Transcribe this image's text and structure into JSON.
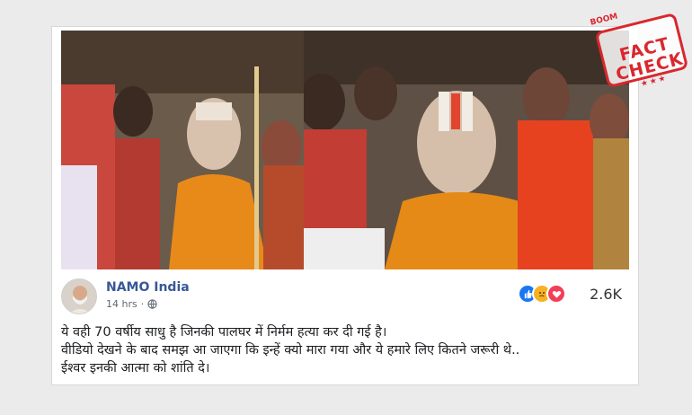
{
  "post": {
    "page_name": "NAMO India",
    "time": "14 hrs",
    "reaction_count": "2.6K",
    "reactions": [
      "like-icon",
      "sad-icon",
      "love-icon"
    ],
    "lines": [
      "ये वही 70 वर्षीय साधु है जिनकी पालघर में निर्मम हत्या कर दी गई है।",
      "वीडियो देखने के बाद समझ आ जाएगा कि इन्हें क्यो मारा गया और ये हमारे लिए कितने जरूरी थे..",
      "ईश्वर इनकी आत्मा को शांति दे।"
    ]
  },
  "stamp": {
    "brand": "BOOM",
    "line1": "FACT",
    "line2": "CHECK",
    "stars": "★★★"
  },
  "colors": {
    "page_name": "#385898",
    "stamp_red": "#d9272e",
    "like_blue": "#1877f2"
  }
}
